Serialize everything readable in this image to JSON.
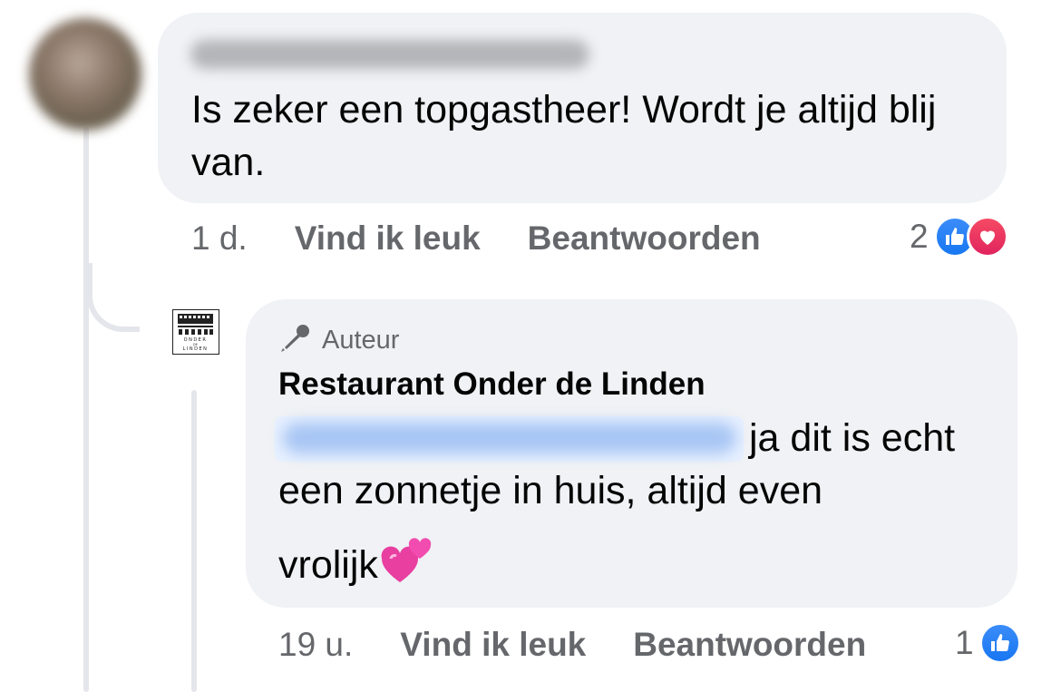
{
  "comment": {
    "text": "Is zeker een topgastheer! Wordt je altijd blij van.",
    "time": "1 d.",
    "like_label": "Vind ik leuk",
    "reply_label": "Beantwoorden",
    "reaction_count": "2"
  },
  "reply": {
    "badge_label": "Auteur",
    "author": "Restaurant Onder de Linden",
    "text_line1": "ja dit is echt",
    "text_line2": "een zonnetje in huis, altijd even",
    "text_line3": "vrolijk",
    "time": "19 u.",
    "like_label": "Vind ik leuk",
    "reply_label": "Beantwoorden",
    "reaction_count": "1"
  },
  "logo_text": "ONDER DE LINDEN",
  "icons": {
    "author_badge": "microphone-icon",
    "like": "like-icon",
    "love": "love-icon",
    "emoji": "two-hearts-icon"
  },
  "colors": {
    "bubble": "#f0f2f5",
    "secondary_text": "#65676b",
    "like_blue": "#1877f2",
    "love_red": "#e0245e"
  }
}
